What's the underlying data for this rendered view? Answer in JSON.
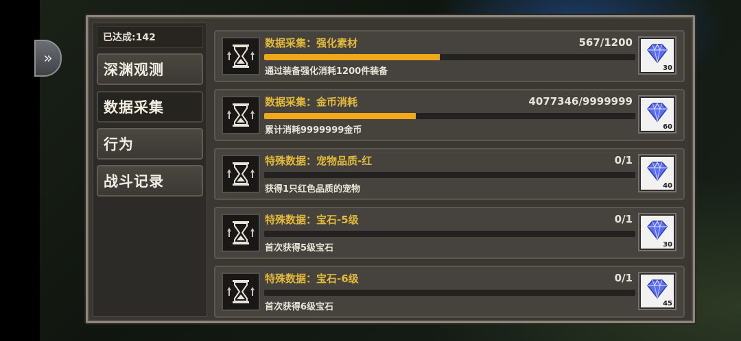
{
  "achieved_label": "已达成:142",
  "tabs": [
    {
      "label": "深渊观测",
      "active": false
    },
    {
      "label": "数据采集",
      "active": true
    },
    {
      "label": "行为",
      "active": false
    },
    {
      "label": "战斗记录",
      "active": false
    }
  ],
  "achievements": [
    {
      "title": "数据采集：强化素材",
      "progress_text": "567/1200",
      "progress": 0.4725,
      "desc": "通过装备强化消耗1200件装备",
      "reward_icon": "diamond-icon",
      "reward_count": "30"
    },
    {
      "title": "数据采集：金币消耗",
      "progress_text": "4077346/9999999",
      "progress": 0.4077,
      "desc": "累计消耗9999999金币",
      "reward_icon": "diamond-icon",
      "reward_count": "60"
    },
    {
      "title": "特殊数据：宠物品质-红",
      "progress_text": "0/1",
      "progress": 0,
      "desc": "获得1只红色品质的宠物",
      "reward_icon": "diamond-icon",
      "reward_count": "40"
    },
    {
      "title": "特殊数据：宝石-5级",
      "progress_text": "0/1",
      "progress": 0,
      "desc": "首次获得5级宝石",
      "reward_icon": "diamond-icon",
      "reward_count": "30"
    },
    {
      "title": "特殊数据：宝石-6级",
      "progress_text": "0/1",
      "progress": 0,
      "desc": "首次获得6级宝石",
      "reward_icon": "diamond-icon",
      "reward_count": "45"
    }
  ],
  "colors": {
    "title": "#e3ba3a",
    "bar_fill": "#f0a818",
    "diamond": "#4a5cf0"
  }
}
